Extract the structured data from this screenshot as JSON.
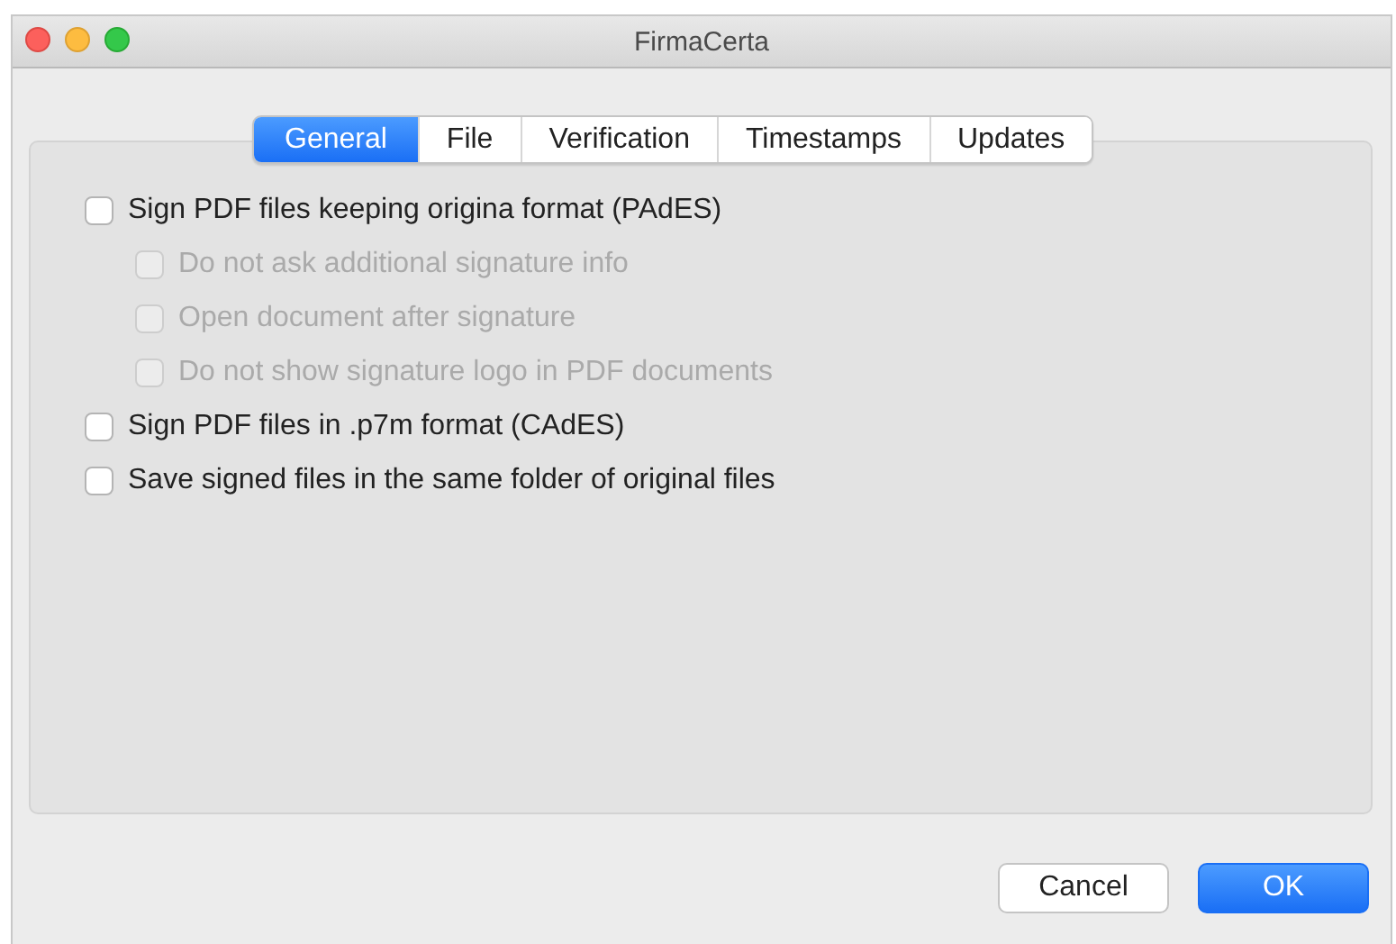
{
  "window": {
    "title": "FirmaCerta"
  },
  "tabs": [
    {
      "label": "General",
      "selected": true
    },
    {
      "label": "File",
      "selected": false
    },
    {
      "label": "Verification",
      "selected": false
    },
    {
      "label": "Timestamps",
      "selected": false
    },
    {
      "label": "Updates",
      "selected": false
    }
  ],
  "options": [
    {
      "label": "Sign PDF files keeping origina format (PAdES)",
      "checked": false,
      "disabled": false,
      "children": [
        {
          "label": "Do not ask additional signature info",
          "checked": false,
          "disabled": true
        },
        {
          "label": "Open document after signature",
          "checked": false,
          "disabled": true
        },
        {
          "label": "Do not show signature logo in PDF documents",
          "checked": false,
          "disabled": true
        }
      ]
    },
    {
      "label": "Sign PDF files in .p7m format (CAdES)",
      "checked": false,
      "disabled": false
    },
    {
      "label": "Save signed files in the same folder of original files",
      "checked": false,
      "disabled": false
    }
  ],
  "buttons": [
    {
      "label": "Cancel",
      "kind": "plain"
    },
    {
      "label": "OK",
      "kind": "default"
    }
  ]
}
